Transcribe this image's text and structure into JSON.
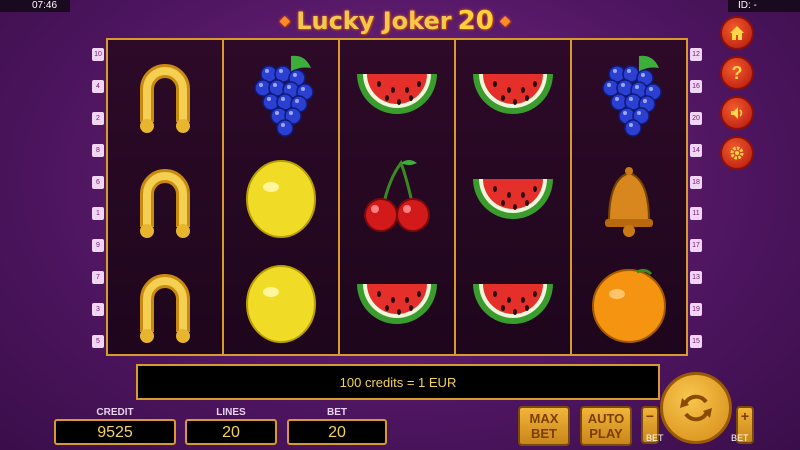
{
  "top": {
    "time": "07:46",
    "id": "ID: -"
  },
  "title": {
    "left_ornament": "◆",
    "right_ornament": "◆",
    "text": "Lucky Joker",
    "number": "20"
  },
  "reels": [
    [
      "horseshoe",
      "horseshoe",
      "horseshoe"
    ],
    [
      "grapes",
      "lemon",
      "lemon"
    ],
    [
      "watermelon",
      "cherries",
      "watermelon"
    ],
    [
      "watermelon",
      "watermelon",
      "watermelon"
    ],
    [
      "grapes",
      "bell",
      "orange"
    ]
  ],
  "lines_left": [
    "10",
    "4",
    "2",
    "8",
    "6",
    "1",
    "9",
    "7",
    "3",
    "5"
  ],
  "lines_right": [
    "12",
    "16",
    "20",
    "14",
    "18",
    "11",
    "17",
    "13",
    "19",
    "15"
  ],
  "side_buttons": [
    "home-icon",
    "help-icon",
    "sound-icon",
    "settings-icon"
  ],
  "info": {
    "message": "100 credits = 1 EUR"
  },
  "bottom": {
    "credit_label": "CREDIT",
    "credit_value": "9525",
    "lines_label": "LINES",
    "lines_value": "20",
    "bet_label": "BET",
    "bet_value": "20"
  },
  "controls": {
    "max_bet_line1": "MAX",
    "max_bet_line2": "BET",
    "auto_play_line1": "AUTO",
    "auto_play_line2": "PLAY",
    "bet_minus": "−",
    "bet_minus_label": "BET",
    "bet_plus": "+",
    "bet_plus_label": "BET"
  },
  "colors": {
    "accent": "#d79a2b",
    "value_text": "#f5d35a",
    "background": "#4e1560"
  }
}
